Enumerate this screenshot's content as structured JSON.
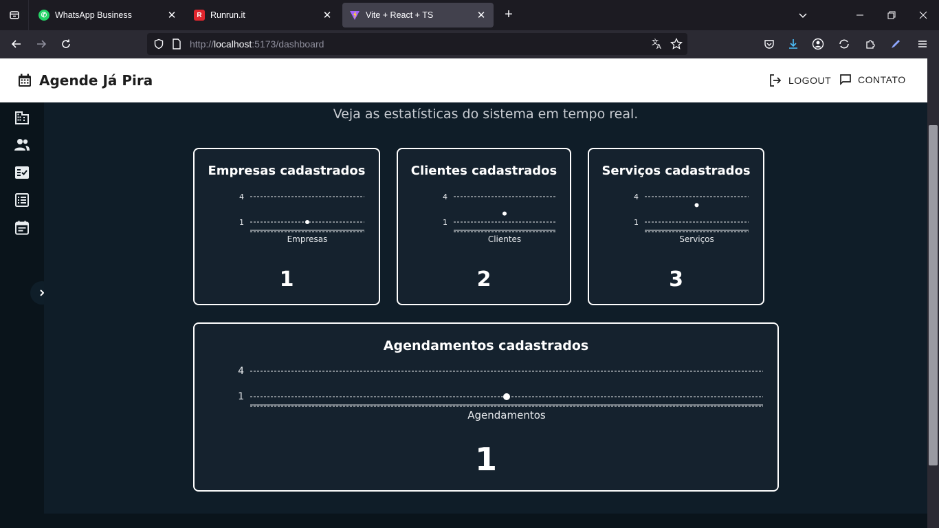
{
  "browser": {
    "tabs": [
      {
        "title": "WhatsApp Business",
        "icon": "whatsapp-icon",
        "color": "#25d366"
      },
      {
        "title": "Runrun.it",
        "icon": "runrun-icon",
        "color": "#e0262e"
      },
      {
        "title": "Vite + React + TS",
        "icon": "vite-icon",
        "color": "#a463ff"
      }
    ],
    "url_prefix": "http://",
    "url_host": "localhost",
    "url_rest": ":5173/dashboard"
  },
  "header": {
    "brand": "Agende Já Pira",
    "logout_label": "LOGOUT",
    "contact_label": "CONTATO"
  },
  "sidebar": {
    "items": [
      {
        "icon": "building-icon"
      },
      {
        "icon": "people-icon"
      },
      {
        "icon": "checklist-icon"
      },
      {
        "icon": "list-icon"
      },
      {
        "icon": "event-note-icon"
      }
    ]
  },
  "main": {
    "subtitle": "Veja as estatísticas do sistema em tempo real."
  },
  "cards": [
    {
      "title": "Empresas cadastrados",
      "value": "1"
    },
    {
      "title": "Clientes cadastrados",
      "value": "2"
    },
    {
      "title": "Serviços cadastrados",
      "value": "3"
    },
    {
      "title": "Agendamentos cadastrados",
      "value": "1"
    }
  ],
  "chart_data": [
    {
      "type": "scatter",
      "categories": [
        "Empresas"
      ],
      "values": [
        1
      ],
      "yticks": [
        "1",
        "4"
      ],
      "xlabel": "Empresas"
    },
    {
      "type": "scatter",
      "categories": [
        "Clientes"
      ],
      "values": [
        2
      ],
      "yticks": [
        "1",
        "4"
      ],
      "xlabel": "Clientes"
    },
    {
      "type": "scatter",
      "categories": [
        "Serviços"
      ],
      "values": [
        3
      ],
      "yticks": [
        "1",
        "4"
      ],
      "xlabel": "Serviços"
    },
    {
      "type": "scatter",
      "categories": [
        "Agendamentos"
      ],
      "values": [
        1
      ],
      "yticks": [
        "1",
        "4"
      ],
      "xlabel": "Agendamentos"
    }
  ],
  "colors": {
    "accent": "#ffffff",
    "card_bg": "#15222e",
    "page_bg": "#0f1d28"
  }
}
